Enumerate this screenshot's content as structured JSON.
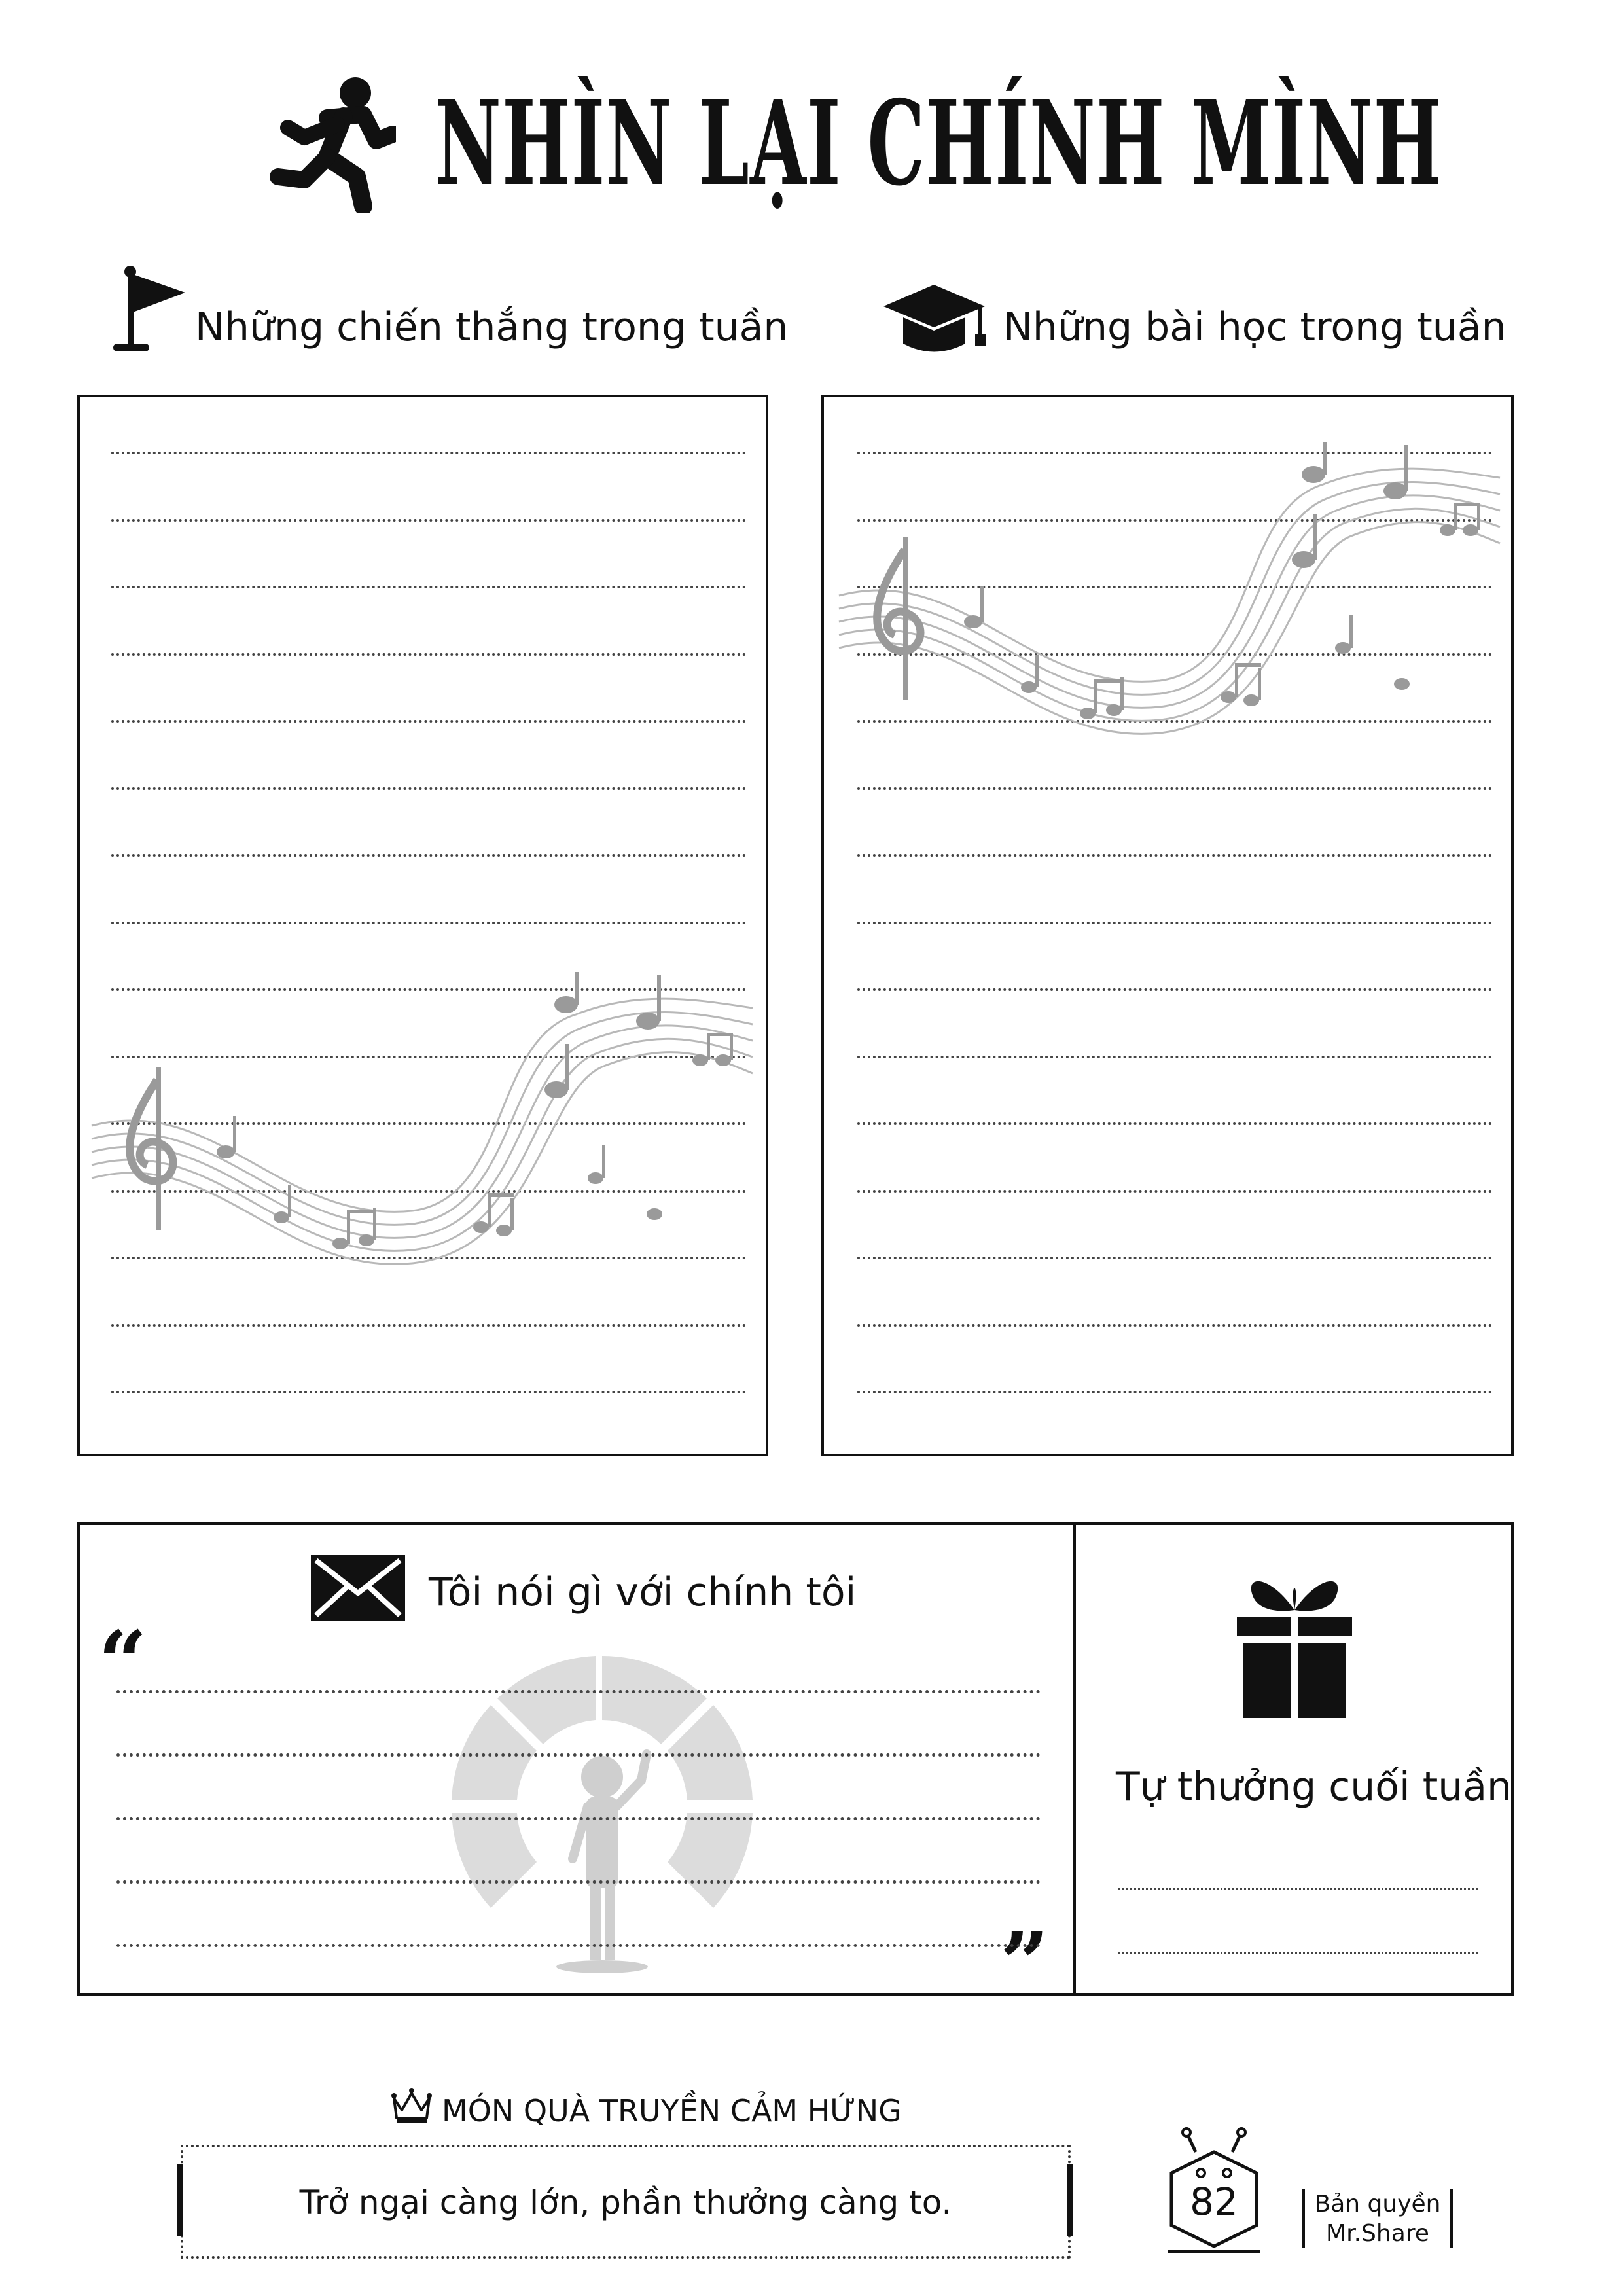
{
  "header": {
    "title": "NHÌN LẠI CHÍNH MÌNH",
    "icon": "running-person-icon"
  },
  "sections": {
    "wins": {
      "label": "Những chiến thắng trong tuần",
      "icon": "flag-icon"
    },
    "lessons": {
      "label": "Những bài học trong tuần",
      "icon": "graduation-cap-icon"
    },
    "self_talk": {
      "label": "Tôi nói gì với chính tôi",
      "icon": "envelope-icon",
      "open_quote": "“",
      "close_quote": "”"
    },
    "reward": {
      "label": "Tự thưởng cuối tuần",
      "icon": "gift-icon"
    }
  },
  "inspiration": {
    "heading": "MÓN QUÀ TRUYỀN CẢM HỨNG",
    "icon": "crown-icon",
    "quote": "Trở ngại càng lớn, phần thưởng càng to."
  },
  "footer": {
    "page_number": "82",
    "copyright_line1": "Bản quyền",
    "copyright_line2": "Mr.Share"
  },
  "colors": {
    "ink": "#111111",
    "watermark": "#d9d9d9",
    "music_gray": "#b0b0b0"
  }
}
